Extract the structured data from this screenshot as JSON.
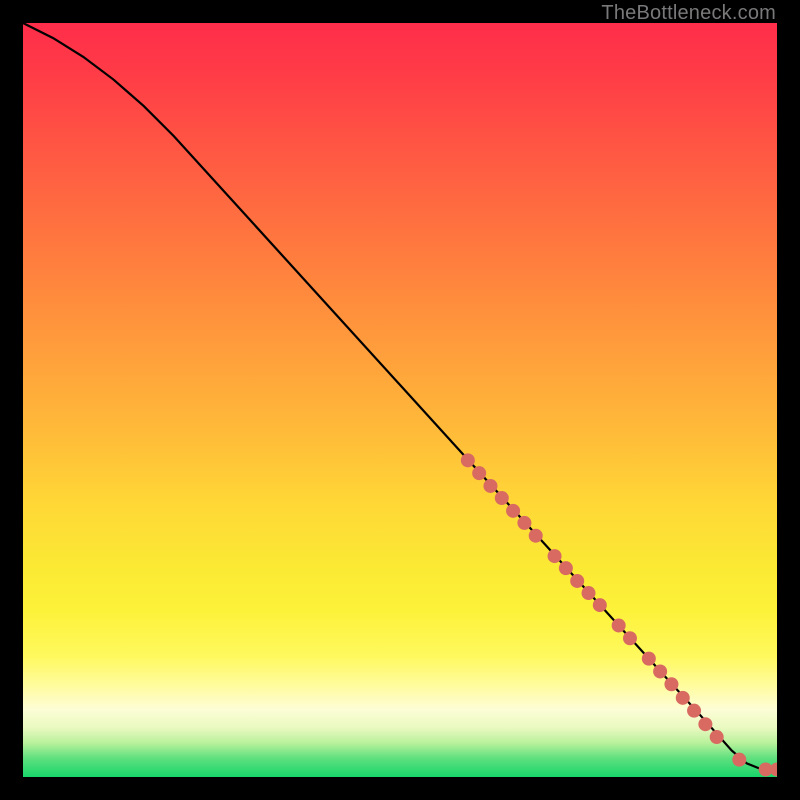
{
  "watermark": "TheBottleneck.com",
  "chart_data": {
    "type": "line",
    "title": "",
    "xlabel": "",
    "ylabel": "",
    "xlim": [
      0,
      100
    ],
    "ylim": [
      0,
      100
    ],
    "grid": false,
    "line": {
      "x": [
        0,
        4,
        8,
        12,
        16,
        20,
        30,
        40,
        50,
        60,
        70,
        80,
        85,
        90,
        94,
        96,
        98,
        100
      ],
      "y": [
        100,
        98,
        95.5,
        92.5,
        89,
        85,
        74,
        63,
        52,
        41,
        30,
        19,
        13.5,
        8,
        3.5,
        1.8,
        1.0,
        1.0
      ],
      "color": "#000000"
    },
    "points": {
      "color_hex": "#d86a62",
      "radius_px": 7,
      "items": [
        {
          "x": 59.0,
          "y": 42.0
        },
        {
          "x": 60.5,
          "y": 40.3
        },
        {
          "x": 62.0,
          "y": 38.6
        },
        {
          "x": 63.5,
          "y": 37.0
        },
        {
          "x": 65.0,
          "y": 35.3
        },
        {
          "x": 66.5,
          "y": 33.7
        },
        {
          "x": 68.0,
          "y": 32.0
        },
        {
          "x": 70.5,
          "y": 29.3
        },
        {
          "x": 72.0,
          "y": 27.7
        },
        {
          "x": 73.5,
          "y": 26.0
        },
        {
          "x": 75.0,
          "y": 24.4
        },
        {
          "x": 76.5,
          "y": 22.8
        },
        {
          "x": 79.0,
          "y": 20.1
        },
        {
          "x": 80.5,
          "y": 18.4
        },
        {
          "x": 83.0,
          "y": 15.7
        },
        {
          "x": 84.5,
          "y": 14.0
        },
        {
          "x": 86.0,
          "y": 12.3
        },
        {
          "x": 87.5,
          "y": 10.5
        },
        {
          "x": 89.0,
          "y": 8.8
        },
        {
          "x": 90.5,
          "y": 7.0
        },
        {
          "x": 92.0,
          "y": 5.3
        },
        {
          "x": 95.0,
          "y": 2.3
        },
        {
          "x": 98.5,
          "y": 1.0
        },
        {
          "x": 100.0,
          "y": 1.0
        }
      ]
    }
  }
}
